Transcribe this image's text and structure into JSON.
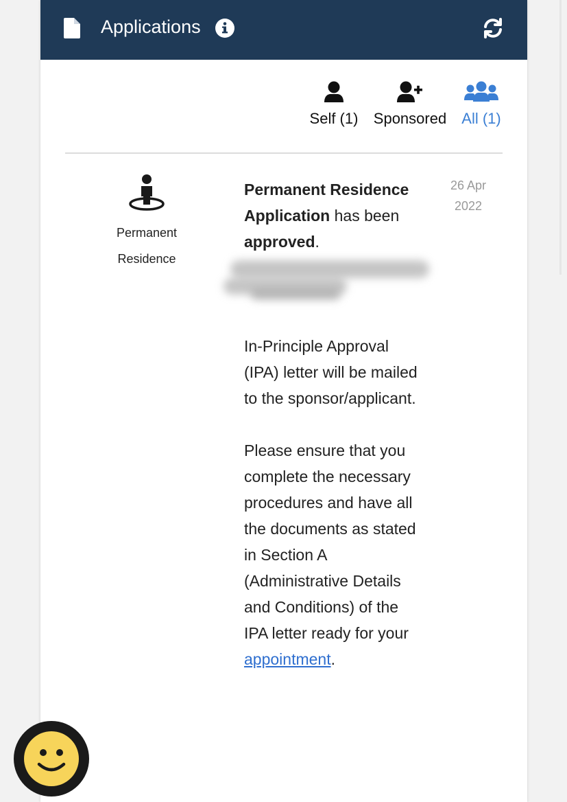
{
  "header": {
    "title": "Applications",
    "icons": {
      "document": "document-icon",
      "info": "info-icon",
      "refresh": "refresh-icon"
    },
    "background": "#1f3a57"
  },
  "filters": [
    {
      "label": "Self (1)",
      "icon": "user-icon",
      "active": false
    },
    {
      "label": "Sponsored",
      "icon": "user-plus-icon",
      "active": false
    },
    {
      "label": "All (1)",
      "icon": "users-icon",
      "active": true
    }
  ],
  "accent": "#3b7fd4",
  "application": {
    "type_line1": "Permanent",
    "type_line2": "Residence",
    "icon": "person-standing-icon",
    "date_line1": "26 Apr",
    "date_line2": "2022",
    "message": {
      "bold1": "Permanent Residence Application",
      "text1": " has been ",
      "bold2": "approved",
      "text2": ".",
      "para2": "In-Principle Approval (IPA) letter will be mailed to the sponsor/applicant.",
      "para3": "Please ensure that you complete the necessary procedures and have all the documents as stated in Section A (Administrative Details and Conditions) of the IPA letter ready for your ",
      "link": "appointment",
      "para3_end": "."
    }
  },
  "feedback": {
    "icon": "smiley-icon"
  }
}
